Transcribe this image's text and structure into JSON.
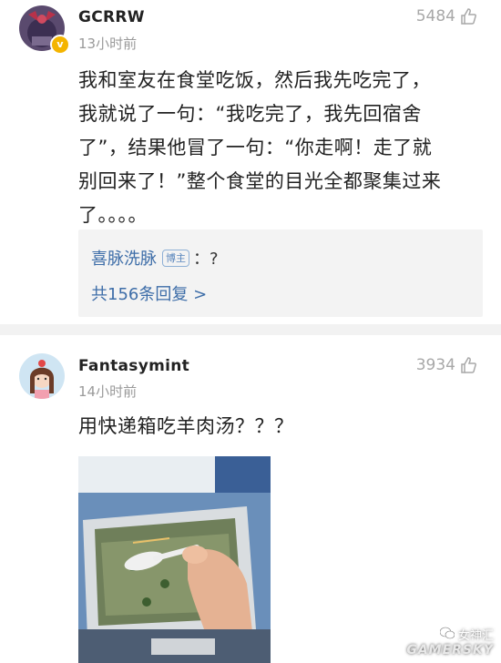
{
  "comments": [
    {
      "username": "GCRRW",
      "time": "13小时前",
      "likes": "5484",
      "verified_icon": "v-badge-icon",
      "text_lines": [
        "我和室友在食堂吃饭，然后我先吃完了，",
        "我就说了一句：“我吃完了，我先回宿舍",
        "了”，结果他冒了一句：“你走啊！走了就",
        "别回来了！”整个食堂的目光全都聚集过来",
        "了。。。。"
      ],
      "replies": {
        "reply_user": "喜脉洗脉",
        "host_tag": "博主",
        "reply_text": "：?",
        "more_label": "共156条回复 >"
      }
    },
    {
      "username": "Fantasymint",
      "time": "14小时前",
      "likes": "3934",
      "text": "用快递箱吃羊肉汤？？？"
    }
  ],
  "watermark": {
    "top": "女神汇",
    "bottom": "GAMERSKY"
  },
  "colors": {
    "link": "#3d6da8",
    "muted": "#9a9a9a",
    "badge": "#f4b400"
  }
}
